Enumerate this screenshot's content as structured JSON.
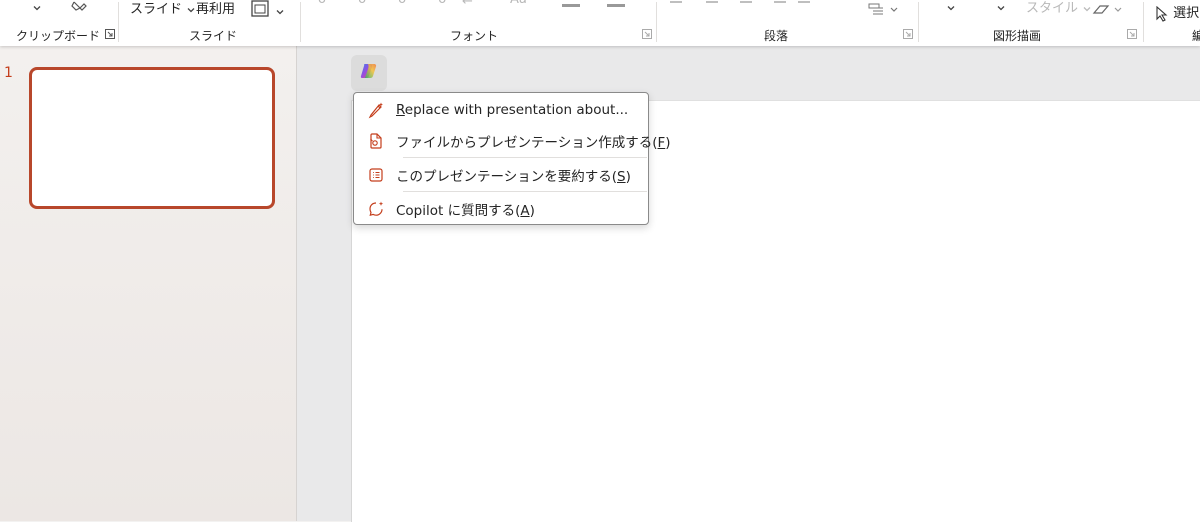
{
  "ribbon": {
    "clipboard_label": "クリップボード",
    "slides_label": "スライド",
    "font_label": "フォント",
    "paragraph_label": "段落",
    "drawing_label": "図形描画",
    "new_slide_label": "スライド",
    "reuse_label": "再利用",
    "style_label": "スタイル",
    "select_label": "選択",
    "font_extra": "Aa",
    "clipped_group_label": "編"
  },
  "thumbnails": {
    "slide_number": "1"
  },
  "copilot": {
    "button_icon": "copilot-icon",
    "menu": [
      {
        "icon": "pen-sparkle-icon",
        "text_parts": [
          "",
          "R",
          "eplace with presentation about..."
        ]
      },
      {
        "icon": "document-sparkle-icon",
        "text_parts": [
          "ファイルからプレゼンテーション作成する(",
          "F",
          ")"
        ]
      },
      {
        "icon": "list-summary-icon",
        "text_parts": [
          "このプレゼンテーションを要約する(",
          "S",
          ")"
        ]
      },
      {
        "icon": "chat-sparkle-icon",
        "text_parts": [
          "Copilot に質問する(",
          "A",
          ")"
        ]
      }
    ]
  },
  "colors": {
    "accent": "#c43e1c",
    "thumb_border": "#b8472b",
    "menu_border": "#8a8a8a"
  }
}
